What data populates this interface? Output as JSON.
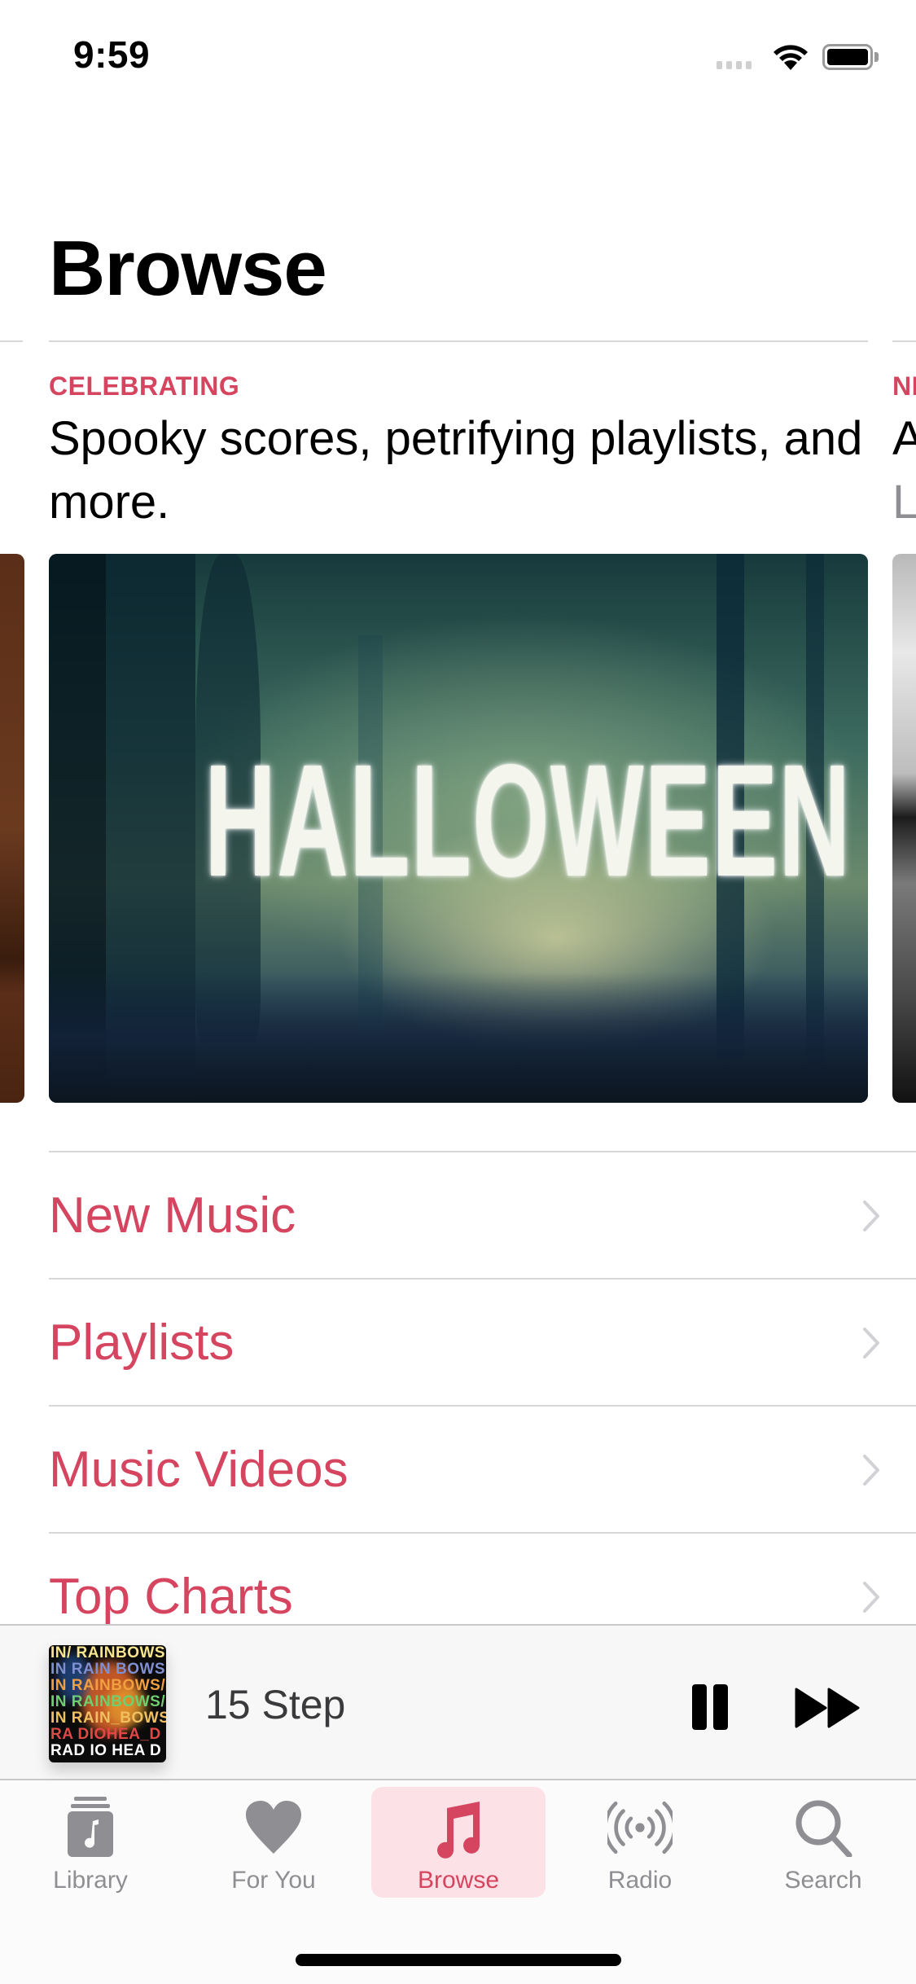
{
  "status_bar": {
    "time": "9:59",
    "wifi_icon": "wifi-icon",
    "battery_icon": "battery-icon",
    "signal_icon": "cellular-signal-icon"
  },
  "header": {
    "title": "Browse"
  },
  "carousel": {
    "cards": [
      {
        "eyebrow": "CELEBRATING",
        "title": "Spooky scores, petrifying playlists, and more.",
        "image_text": "HALLOWEEN"
      },
      {
        "eyebrow": "NE",
        "title": "A",
        "subtitle": "L"
      }
    ]
  },
  "list": {
    "items": [
      {
        "label": "New Music"
      },
      {
        "label": "Playlists"
      },
      {
        "label": "Music Videos"
      },
      {
        "label": "Top Charts"
      }
    ]
  },
  "now_playing": {
    "track_title": "15 Step",
    "artwork_rows": [
      "IN/ RAINBOWS",
      "IN RAIN BOWS",
      "IN RAINBOWS/S",
      "IN RAINBOWS/",
      "IN RAIN_BOWS",
      "RA DIOHEA_D",
      " RAD IO HEA D"
    ],
    "pause_icon": "pause-icon",
    "next_icon": "fast-forward-icon"
  },
  "tab_bar": {
    "tabs": [
      {
        "label": "Library",
        "icon": "library-icon",
        "active": false
      },
      {
        "label": "For You",
        "icon": "heart-icon",
        "active": false
      },
      {
        "label": "Browse",
        "icon": "music-note-icon",
        "active": true
      },
      {
        "label": "Radio",
        "icon": "radio-icon",
        "active": false
      },
      {
        "label": "Search",
        "icon": "search-icon",
        "active": false
      }
    ]
  },
  "colors": {
    "accent": "#d6455f",
    "accent_bg": "#fce1e6",
    "inactive": "#8e8e93",
    "divider": "#d8d8d8"
  }
}
